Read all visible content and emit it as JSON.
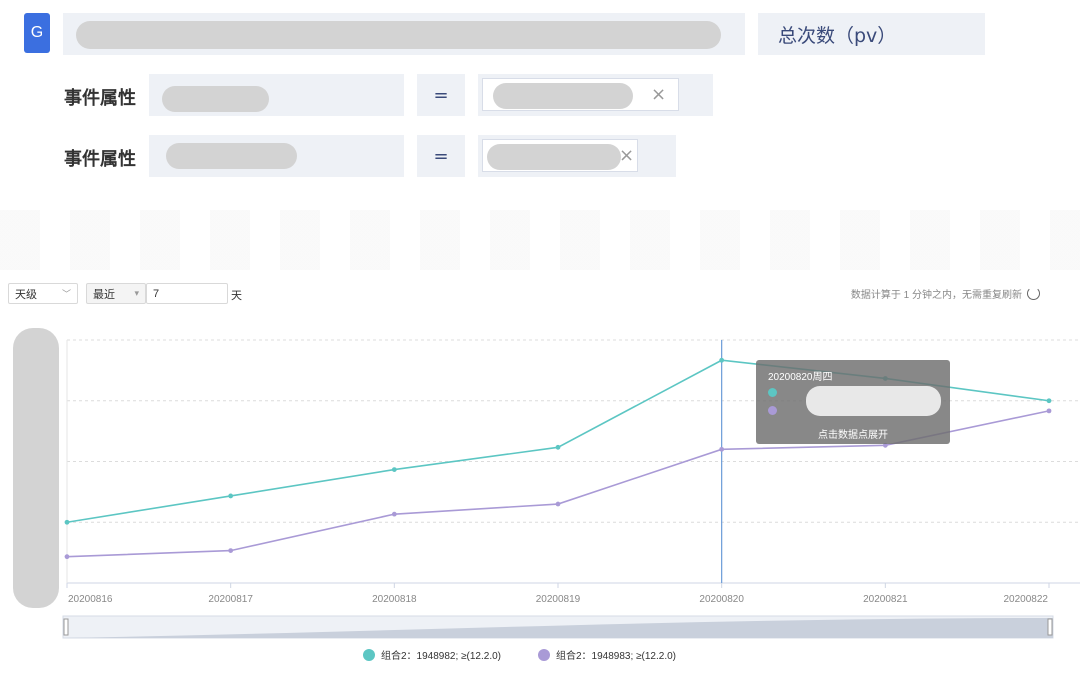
{
  "header": {
    "badge": "G",
    "metric_label": "总次数（pv）"
  },
  "filters": [
    {
      "label": "事件属性",
      "operator": "=",
      "remove_icon": "close-icon"
    },
    {
      "label": "事件属性",
      "operator": "=",
      "remove_icon": "close-icon"
    }
  ],
  "controls": {
    "granularity": "天级",
    "range_mode": "最近",
    "range_value": "7",
    "range_unit": "天",
    "status_note": "数据计算于 1 分钟之内，无需重复刷新"
  },
  "tooltip": {
    "date_label": "20200820周四",
    "action": "点击数据点展开"
  },
  "legend": [
    {
      "name": "组合2：1948982; ≥(12.2.0)",
      "color": "#5cc6c3"
    },
    {
      "name": "组合2：1948983; ≥(12.2.0)",
      "color": "#a99ad6"
    }
  ],
  "colors": {
    "accent": "#3b6fe0",
    "series1": "#5cc6c3",
    "series2": "#a99ad6",
    "crosshair": "#6a9bd8"
  },
  "chart_data": {
    "type": "line",
    "categories": [
      "20200816",
      "20200817",
      "20200818",
      "20200819",
      "20200820",
      "20200821",
      "20200822"
    ],
    "series": [
      {
        "name": "组合2：1948982; ≥(12.2.0)",
        "values": [
          30,
          43,
          56,
          67,
          110,
          101,
          90
        ]
      },
      {
        "name": "组合2：1948983; ≥(12.2.0)",
        "values": [
          13,
          16,
          34,
          39,
          66,
          68,
          85
        ]
      }
    ],
    "ylim": [
      0,
      120
    ],
    "grid": true,
    "legend_position": "bottom",
    "highlighted_category": "20200820"
  }
}
